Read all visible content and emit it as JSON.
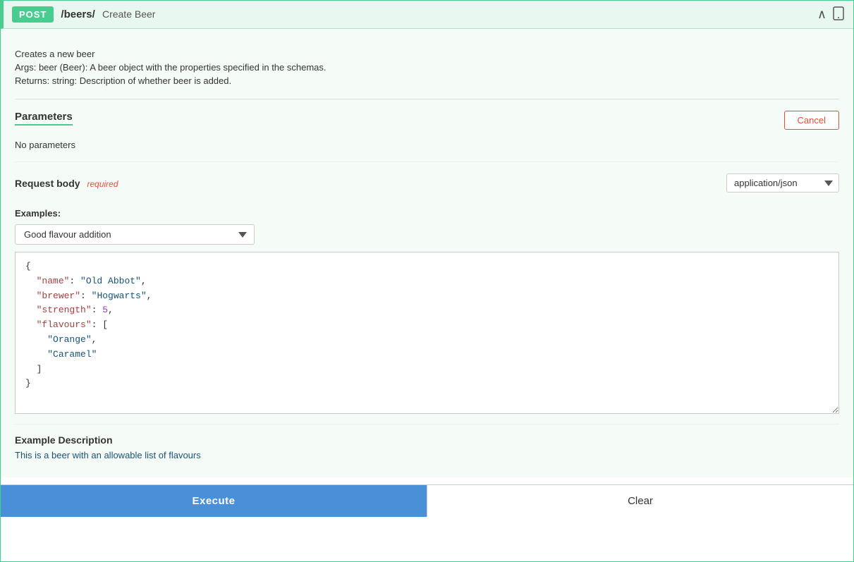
{
  "header": {
    "method": "POST",
    "path": "/beers/",
    "title": "Create Beer",
    "collapse_icon": "∧",
    "mobile_icon": "📱"
  },
  "description": {
    "line1": "Creates a new beer",
    "line2": "Args: beer (Beer): A beer object with the properties specified in the schemas.",
    "line3": "Returns: string: Description of whether beer is added."
  },
  "parameters": {
    "section_title": "Parameters",
    "cancel_label": "Cancel",
    "no_params_text": "No parameters"
  },
  "request_body": {
    "title": "Request body",
    "required_label": "required",
    "content_type_options": [
      "application/json"
    ],
    "content_type_selected": "application/json"
  },
  "examples": {
    "label": "Examples:",
    "selected": "Good flavour addition",
    "options": [
      "Good flavour addition"
    ]
  },
  "json_content": {
    "raw": "{\n  \"name\": \"Old Abbot\",\n  \"brewer\": \"Hogwarts\",\n  \"strength\": 5,\n  \"flavours\": [\n    \"Orange\",\n    \"Caramel\"\n  ]\n}"
  },
  "example_description": {
    "title": "Example Description",
    "text": "This is a beer with an allowable list of flavours"
  },
  "actions": {
    "execute_label": "Execute",
    "clear_label": "Clear"
  }
}
